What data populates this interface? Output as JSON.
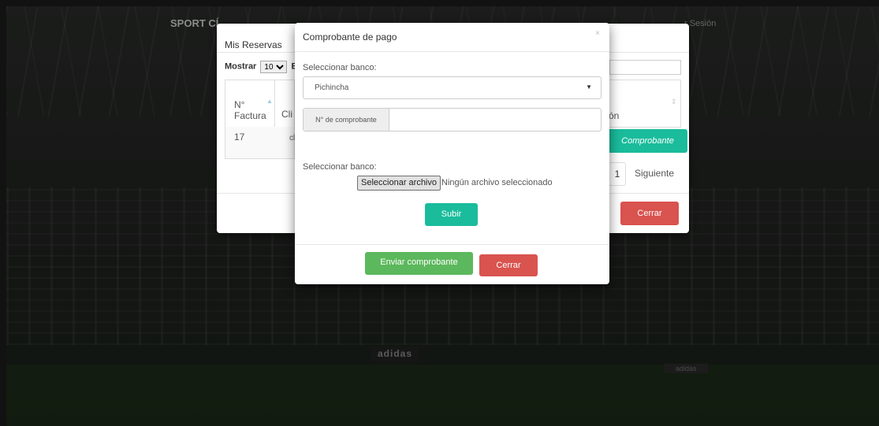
{
  "navbar": {
    "brand": "SPORT CÍ",
    "session": "r Sesión"
  },
  "reservas_modal": {
    "title": "Mis Reservas",
    "length_label": "Mostrar",
    "length_value": "10",
    "length_suffix": "Er",
    "columns": {
      "numero": "N° Factura",
      "cliente": "Cli",
      "accion": "ón"
    },
    "row": {
      "numero": "17",
      "cliente_line1": "clier",
      "cliente_line2": "clier",
      "accion_button": "Comprobante"
    },
    "pagination": {
      "page": "1",
      "next": "Siguiente"
    },
    "close_button": "Cerrar"
  },
  "comprobante_modal": {
    "title": "Comprobante de pago",
    "close_icon": "×",
    "bank_label": "Seleccionar banco:",
    "bank_select_value": "Pichincha",
    "receipt_addon": "N° de comprobante",
    "receipt_value": "",
    "file_label": "Seleccionar banco:",
    "file_button": "Seleccionar archivo",
    "file_status": "Ningún archivo seleccionado",
    "upload_button": "Subir",
    "send_button": "Enviar comprobante",
    "close_button": "Cerrar"
  },
  "background": {
    "sponsor1": "adidas",
    "sponsor2": "adidas"
  },
  "colors": {
    "accent_teal": "#1abc9c",
    "success_green": "#5cb85c",
    "danger_red": "#d9534f"
  }
}
